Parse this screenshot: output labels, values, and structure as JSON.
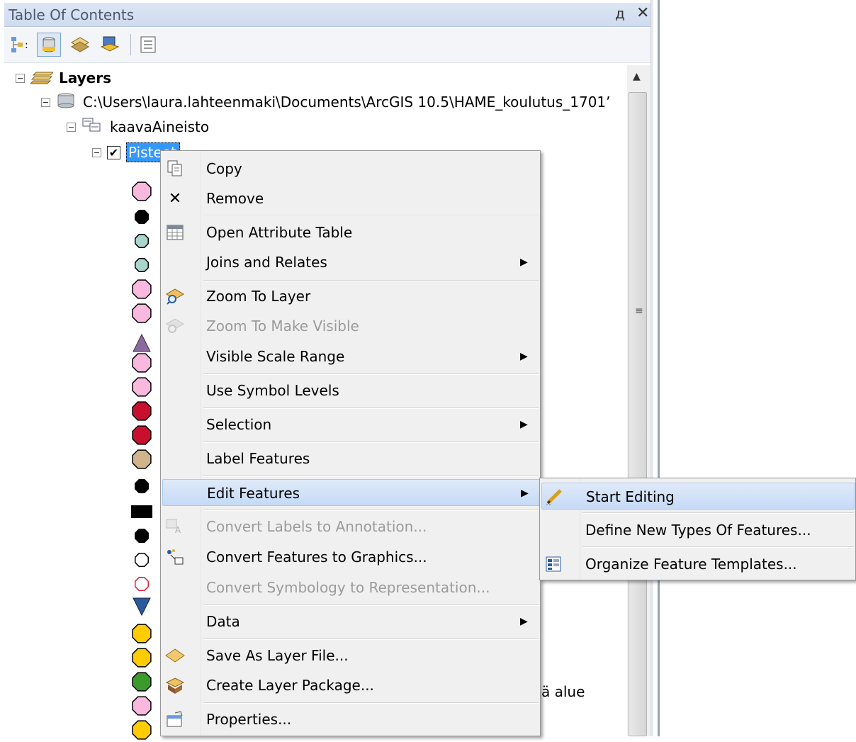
{
  "panel": {
    "title": "Table Of Contents",
    "pin_glyph": "д",
    "close_glyph": "✕"
  },
  "tree": {
    "root_label": "Layers",
    "path_label": "C:\\Users\\laura.lahteenmaki\\Documents\\ArcGIS 10.5\\HAME_koulutus_1701’",
    "dataset_label": "kaavaAineisto",
    "layer_label": "Pisteet",
    "behind_text": "ä alue"
  },
  "context_menu": {
    "items": [
      {
        "label": "Copy",
        "icon": "copy-icon"
      },
      {
        "label": "Remove",
        "icon": "remove-icon"
      },
      {
        "label": "Open Attribute Table",
        "icon": "table-icon"
      },
      {
        "label": "Joins and Relates",
        "icon": "",
        "submenu": true
      },
      {
        "label": "Zoom To Layer",
        "icon": "zoom-to-layer-icon"
      },
      {
        "label": "Zoom To Make Visible",
        "icon": "zoom-visible-icon",
        "disabled": true
      },
      {
        "label": "Visible Scale Range",
        "icon": "",
        "submenu": true
      },
      {
        "label": "Use Symbol Levels",
        "icon": ""
      },
      {
        "label": "Selection",
        "icon": "",
        "submenu": true
      },
      {
        "label": "Label Features",
        "icon": ""
      },
      {
        "label": "Edit Features",
        "icon": "",
        "submenu": true,
        "highlighted": true
      },
      {
        "label": "Convert Labels to Annotation...",
        "icon": "convert-labels-icon",
        "disabled": true
      },
      {
        "label": "Convert Features to Graphics...",
        "icon": "convert-graphics-icon"
      },
      {
        "label": "Convert Symbology to Representation...",
        "icon": "",
        "disabled": true
      },
      {
        "label": "Data",
        "icon": "",
        "submenu": true
      },
      {
        "label": "Save As Layer File...",
        "icon": "layer-file-icon"
      },
      {
        "label": "Create Layer Package...",
        "icon": "layer-package-icon"
      },
      {
        "label": "Properties...",
        "icon": "properties-icon"
      }
    ]
  },
  "submenu": {
    "items": [
      {
        "label": "Start Editing",
        "icon": "pencil-icon",
        "highlighted": true
      },
      {
        "label": "Define New Types Of Features...",
        "icon": ""
      },
      {
        "label": "Organize Feature Templates...",
        "icon": "templates-icon"
      }
    ]
  },
  "colors": {
    "highlight": "#c6daf6",
    "selection": "#3399ff",
    "symbol_pink": "#f9b8dd",
    "symbol_teal": "#a8d6cc",
    "symbol_red": "#c8102e",
    "symbol_tan": "#d2b48c",
    "symbol_yellow": "#ffcc00",
    "symbol_green": "#3a9a2a",
    "symbol_purple": "#8a6a9e",
    "symbol_blue": "#2a5a9e"
  }
}
